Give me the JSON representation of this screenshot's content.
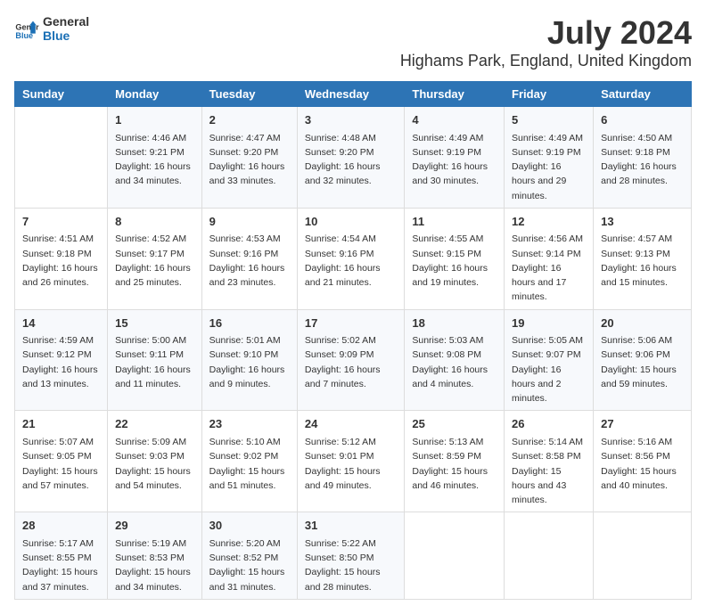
{
  "logo": {
    "line1": "General",
    "line2": "Blue"
  },
  "title": "July 2024",
  "subtitle": "Highams Park, England, United Kingdom",
  "days_header": [
    "Sunday",
    "Monday",
    "Tuesday",
    "Wednesday",
    "Thursday",
    "Friday",
    "Saturday"
  ],
  "rows": [
    [
      {
        "num": "",
        "sunrise": "",
        "sunset": "",
        "daylight": ""
      },
      {
        "num": "1",
        "sunrise": "Sunrise: 4:46 AM",
        "sunset": "Sunset: 9:21 PM",
        "daylight": "Daylight: 16 hours and 34 minutes."
      },
      {
        "num": "2",
        "sunrise": "Sunrise: 4:47 AM",
        "sunset": "Sunset: 9:20 PM",
        "daylight": "Daylight: 16 hours and 33 minutes."
      },
      {
        "num": "3",
        "sunrise": "Sunrise: 4:48 AM",
        "sunset": "Sunset: 9:20 PM",
        "daylight": "Daylight: 16 hours and 32 minutes."
      },
      {
        "num": "4",
        "sunrise": "Sunrise: 4:49 AM",
        "sunset": "Sunset: 9:19 PM",
        "daylight": "Daylight: 16 hours and 30 minutes."
      },
      {
        "num": "5",
        "sunrise": "Sunrise: 4:49 AM",
        "sunset": "Sunset: 9:19 PM",
        "daylight": "Daylight: 16 hours and 29 minutes."
      },
      {
        "num": "6",
        "sunrise": "Sunrise: 4:50 AM",
        "sunset": "Sunset: 9:18 PM",
        "daylight": "Daylight: 16 hours and 28 minutes."
      }
    ],
    [
      {
        "num": "7",
        "sunrise": "Sunrise: 4:51 AM",
        "sunset": "Sunset: 9:18 PM",
        "daylight": "Daylight: 16 hours and 26 minutes."
      },
      {
        "num": "8",
        "sunrise": "Sunrise: 4:52 AM",
        "sunset": "Sunset: 9:17 PM",
        "daylight": "Daylight: 16 hours and 25 minutes."
      },
      {
        "num": "9",
        "sunrise": "Sunrise: 4:53 AM",
        "sunset": "Sunset: 9:16 PM",
        "daylight": "Daylight: 16 hours and 23 minutes."
      },
      {
        "num": "10",
        "sunrise": "Sunrise: 4:54 AM",
        "sunset": "Sunset: 9:16 PM",
        "daylight": "Daylight: 16 hours and 21 minutes."
      },
      {
        "num": "11",
        "sunrise": "Sunrise: 4:55 AM",
        "sunset": "Sunset: 9:15 PM",
        "daylight": "Daylight: 16 hours and 19 minutes."
      },
      {
        "num": "12",
        "sunrise": "Sunrise: 4:56 AM",
        "sunset": "Sunset: 9:14 PM",
        "daylight": "Daylight: 16 hours and 17 minutes."
      },
      {
        "num": "13",
        "sunrise": "Sunrise: 4:57 AM",
        "sunset": "Sunset: 9:13 PM",
        "daylight": "Daylight: 16 hours and 15 minutes."
      }
    ],
    [
      {
        "num": "14",
        "sunrise": "Sunrise: 4:59 AM",
        "sunset": "Sunset: 9:12 PM",
        "daylight": "Daylight: 16 hours and 13 minutes."
      },
      {
        "num": "15",
        "sunrise": "Sunrise: 5:00 AM",
        "sunset": "Sunset: 9:11 PM",
        "daylight": "Daylight: 16 hours and 11 minutes."
      },
      {
        "num": "16",
        "sunrise": "Sunrise: 5:01 AM",
        "sunset": "Sunset: 9:10 PM",
        "daylight": "Daylight: 16 hours and 9 minutes."
      },
      {
        "num": "17",
        "sunrise": "Sunrise: 5:02 AM",
        "sunset": "Sunset: 9:09 PM",
        "daylight": "Daylight: 16 hours and 7 minutes."
      },
      {
        "num": "18",
        "sunrise": "Sunrise: 5:03 AM",
        "sunset": "Sunset: 9:08 PM",
        "daylight": "Daylight: 16 hours and 4 minutes."
      },
      {
        "num": "19",
        "sunrise": "Sunrise: 5:05 AM",
        "sunset": "Sunset: 9:07 PM",
        "daylight": "Daylight: 16 hours and 2 minutes."
      },
      {
        "num": "20",
        "sunrise": "Sunrise: 5:06 AM",
        "sunset": "Sunset: 9:06 PM",
        "daylight": "Daylight: 15 hours and 59 minutes."
      }
    ],
    [
      {
        "num": "21",
        "sunrise": "Sunrise: 5:07 AM",
        "sunset": "Sunset: 9:05 PM",
        "daylight": "Daylight: 15 hours and 57 minutes."
      },
      {
        "num": "22",
        "sunrise": "Sunrise: 5:09 AM",
        "sunset": "Sunset: 9:03 PM",
        "daylight": "Daylight: 15 hours and 54 minutes."
      },
      {
        "num": "23",
        "sunrise": "Sunrise: 5:10 AM",
        "sunset": "Sunset: 9:02 PM",
        "daylight": "Daylight: 15 hours and 51 minutes."
      },
      {
        "num": "24",
        "sunrise": "Sunrise: 5:12 AM",
        "sunset": "Sunset: 9:01 PM",
        "daylight": "Daylight: 15 hours and 49 minutes."
      },
      {
        "num": "25",
        "sunrise": "Sunrise: 5:13 AM",
        "sunset": "Sunset: 8:59 PM",
        "daylight": "Daylight: 15 hours and 46 minutes."
      },
      {
        "num": "26",
        "sunrise": "Sunrise: 5:14 AM",
        "sunset": "Sunset: 8:58 PM",
        "daylight": "Daylight: 15 hours and 43 minutes."
      },
      {
        "num": "27",
        "sunrise": "Sunrise: 5:16 AM",
        "sunset": "Sunset: 8:56 PM",
        "daylight": "Daylight: 15 hours and 40 minutes."
      }
    ],
    [
      {
        "num": "28",
        "sunrise": "Sunrise: 5:17 AM",
        "sunset": "Sunset: 8:55 PM",
        "daylight": "Daylight: 15 hours and 37 minutes."
      },
      {
        "num": "29",
        "sunrise": "Sunrise: 5:19 AM",
        "sunset": "Sunset: 8:53 PM",
        "daylight": "Daylight: 15 hours and 34 minutes."
      },
      {
        "num": "30",
        "sunrise": "Sunrise: 5:20 AM",
        "sunset": "Sunset: 8:52 PM",
        "daylight": "Daylight: 15 hours and 31 minutes."
      },
      {
        "num": "31",
        "sunrise": "Sunrise: 5:22 AM",
        "sunset": "Sunset: 8:50 PM",
        "daylight": "Daylight: 15 hours and 28 minutes."
      },
      {
        "num": "",
        "sunrise": "",
        "sunset": "",
        "daylight": ""
      },
      {
        "num": "",
        "sunrise": "",
        "sunset": "",
        "daylight": ""
      },
      {
        "num": "",
        "sunrise": "",
        "sunset": "",
        "daylight": ""
      }
    ]
  ]
}
